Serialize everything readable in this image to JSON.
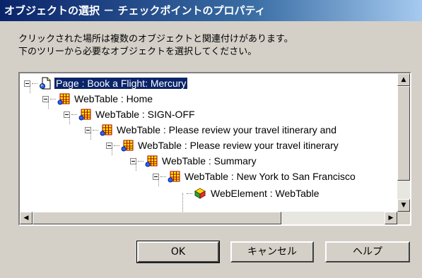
{
  "dialog": {
    "title": "オブジェクトの選択 － チェックポイントのプロパティ",
    "message_line1": "クリックされた場所は複数のオブジェクトと関連付けがあります。",
    "message_line2": "下のツリーから必要なオブジェクトを選択してください。"
  },
  "tree": {
    "nodes": [
      {
        "label": "Page : Book a Flight: Mercury",
        "icon": "page-icon",
        "selected": true
      },
      {
        "label": "WebTable : Home",
        "icon": "webtable-icon"
      },
      {
        "label": "WebTable : SIGN-OFF",
        "icon": "webtable-icon"
      },
      {
        "label": "WebTable : Please review your travel itinerary and",
        "icon": "webtable-icon"
      },
      {
        "label": "WebTable : Please review your travel itinerary",
        "icon": "webtable-icon"
      },
      {
        "label": "WebTable : Summary",
        "icon": "webtable-icon"
      },
      {
        "label": "WebTable : New York to San Francisco",
        "icon": "webtable-icon"
      },
      {
        "label": "WebElement : WebTable",
        "icon": "webelement-icon"
      }
    ]
  },
  "buttons": {
    "ok": "OK",
    "cancel": "キャンセル",
    "help": "ヘルプ"
  },
  "colors": {
    "title_bar": "#0a246a",
    "selection": "#0a246a",
    "dialog_bg": "#d4d0c8"
  }
}
